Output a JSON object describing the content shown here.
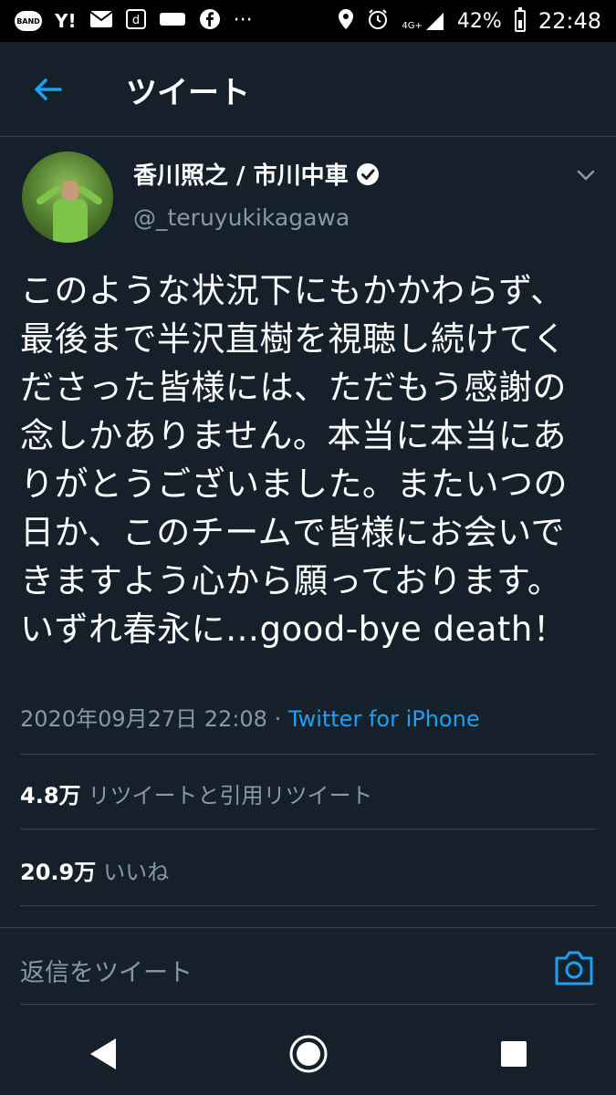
{
  "status_bar": {
    "left_icons": [
      "band-icon",
      "yahoo-icon",
      "mail-icon",
      "d-app-icon",
      "sports-icon",
      "facebook-icon",
      "more-dots-icon"
    ],
    "band_label": "BAND",
    "yahoo_label": "Y!",
    "network": "4G+",
    "battery": "42%",
    "time": "22:48"
  },
  "header": {
    "title": "ツイート"
  },
  "tweet": {
    "author_name": "香川照之 / 市川中車",
    "handle": "@_teruyukikagawa",
    "text": "このような状況下にもかかわらず、最後まで半沢直樹を視聴し続けてくださった皆様には、ただもう感謝の念しかありません。本当に本当にありがとうございました。またいつの日か、このチームで皆様にお会いできますよう心から願っております。いずれ春永に…good-bye death！",
    "timestamp": "2020年09月27日 22:08",
    "separator": "·",
    "source": "Twitter for iPhone"
  },
  "stats": {
    "retweets_count": "4.8万",
    "retweets_label": "リツイートと引用リツイート",
    "likes_count": "20.9万",
    "likes_label": "いいね"
  },
  "reply": {
    "placeholder": "返信をツイート"
  },
  "colors": {
    "background": "#15202b",
    "accent": "#1da1f2",
    "secondary_text": "#8899a6",
    "divider": "#38444d"
  }
}
